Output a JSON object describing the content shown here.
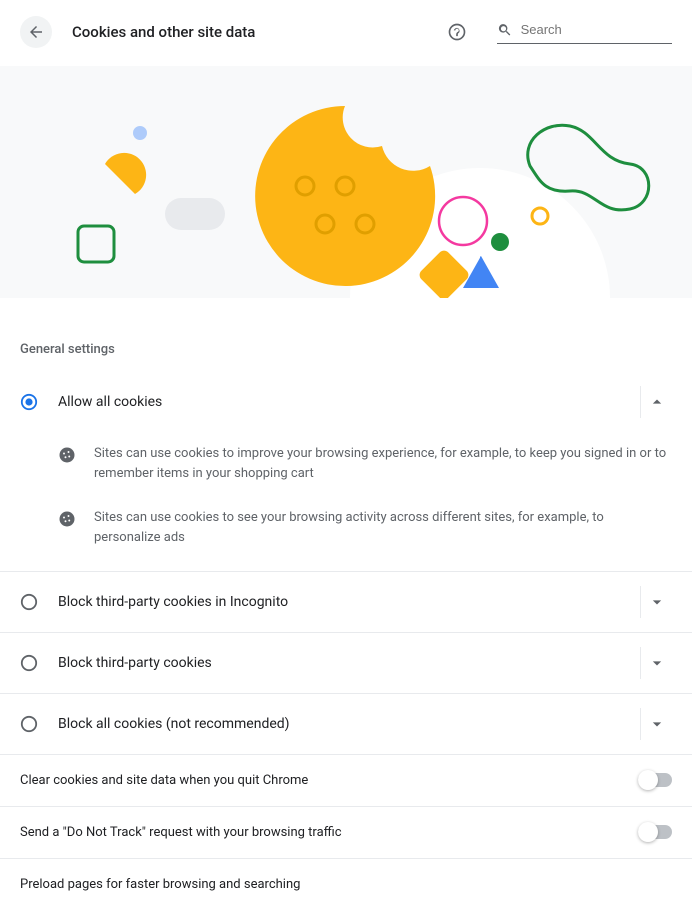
{
  "header": {
    "title": "Cookies and other site data",
    "search_placeholder": "Search"
  },
  "section_heading": "General settings",
  "options": [
    {
      "label": "Allow all cookies",
      "selected": true,
      "expanded": true,
      "descriptions": [
        "Sites can use cookies to improve your browsing experience, for example, to keep you signed in or to remember items in your shopping cart",
        "Sites can use cookies to see your browsing activity across different sites, for example, to personalize ads"
      ]
    },
    {
      "label": "Block third-party cookies in Incognito",
      "selected": false,
      "expanded": false
    },
    {
      "label": "Block third-party cookies",
      "selected": false,
      "expanded": false
    },
    {
      "label": "Block all cookies (not recommended)",
      "selected": false,
      "expanded": false
    }
  ],
  "toggles": [
    {
      "label": "Clear cookies and site data when you quit Chrome",
      "on": false
    },
    {
      "label": "Send a \"Do Not Track\" request with your browsing traffic",
      "on": false
    },
    {
      "label": "Preload pages for faster browsing and searching",
      "on": false
    }
  ]
}
